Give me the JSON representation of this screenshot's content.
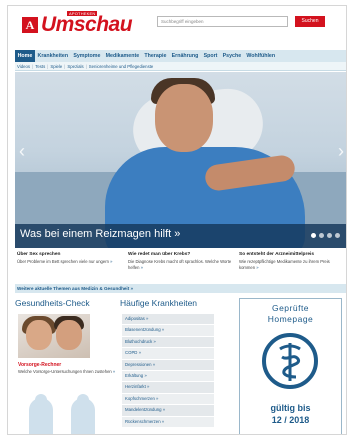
{
  "header": {
    "logo_tag": "APOTHEKEN",
    "logo_name": "Umschau",
    "search_placeholder": "Suchbegriff eingeben",
    "search_button": "Suchen"
  },
  "nav": {
    "items": [
      "Home",
      "Krankheiten",
      "Symptome",
      "Medikamente",
      "Therapie",
      "Ernährung",
      "Sport",
      "Psyche",
      "Wohlfühlen"
    ],
    "active": "Home"
  },
  "subnav": {
    "items": [
      "Videos",
      "Tests",
      "Spiele",
      "Spezials",
      "Seniorenheime und Pflegedienste"
    ]
  },
  "hero": {
    "title": "Was bei einem Reizmagen hilft »",
    "slides": 4
  },
  "teasers": [
    {
      "title": "Über Sex sprechen",
      "text": "Über Probleme im Bett sprechen viele nur ungern",
      "more": "»"
    },
    {
      "title": "Wie redet man über Krebs?",
      "text": "Die Diagnose Krebs macht oft sprachlos. Welche Worte helfen",
      "more": "»"
    },
    {
      "title": "So entsteht der Arzneimittelpreis",
      "text": "Wie rezeptpflichtige Medikamente zu ihrem Preis kommen",
      "more": "»"
    }
  ],
  "more_bar": "Weitere aktuelle Themen aus Medizin & Gesundheit »",
  "health_check": {
    "title": "Gesundheits-Check",
    "vr_title": "Vorsorge-Rechner",
    "vr_text": "Welche Vorsorge-Untersuchungen Ihnen zustehen",
    "vr_more": "»"
  },
  "common_diseases": {
    "title": "Häufige Krankheiten",
    "items": [
      "Adipositas »",
      "Blasenentzündung »",
      "Bluthochdruck »",
      "COPD »",
      "Depressionen »",
      "Erkältung »",
      "Herzinfarkt »",
      "Kopfschmerzen »",
      "Mandelentzündung »",
      "Rückenschmerzen »"
    ]
  },
  "badge": {
    "line1": "Geprüfte",
    "line2": "Homepage",
    "valid1": "gültig bis",
    "valid2": "12 / 2018"
  }
}
